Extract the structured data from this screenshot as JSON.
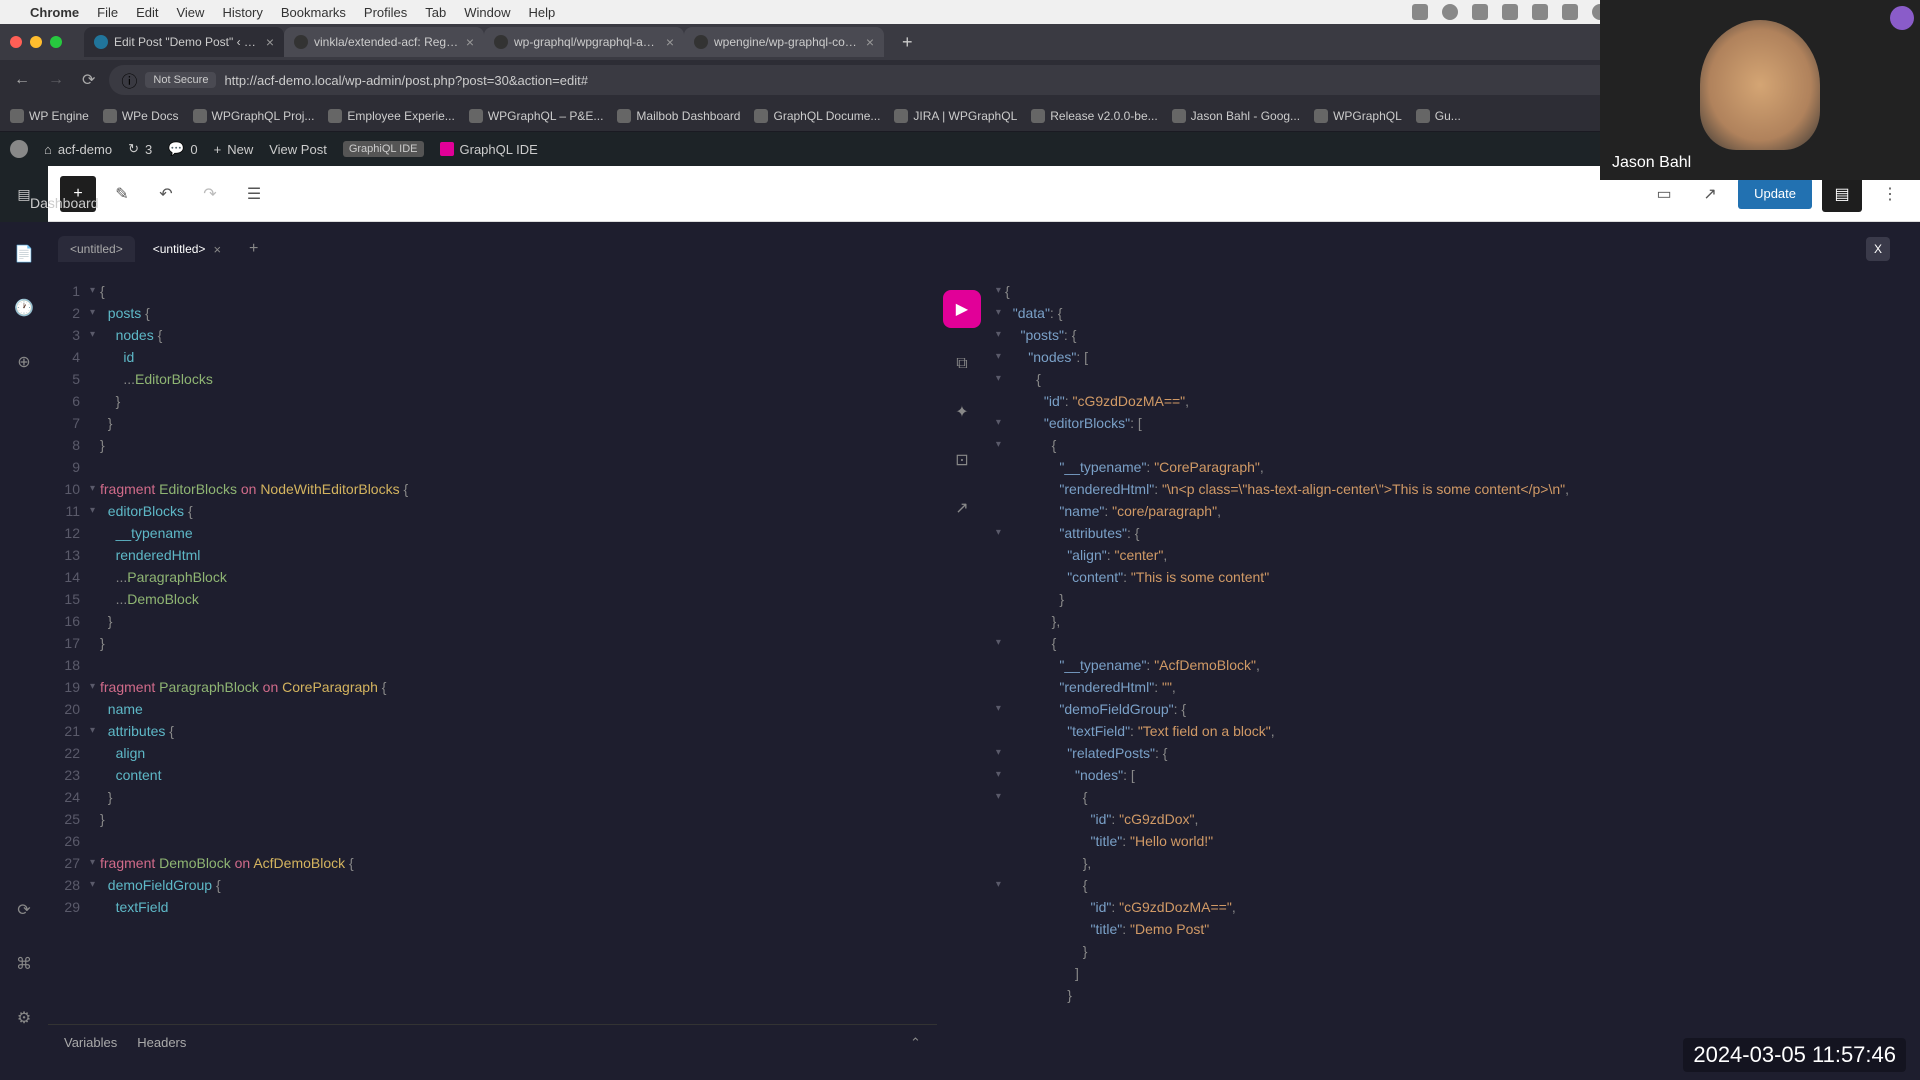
{
  "mac_menu": {
    "app": "Chrome",
    "items": [
      "File",
      "Edit",
      "View",
      "History",
      "Bookmarks",
      "Profiles",
      "Tab",
      "Window",
      "Help"
    ]
  },
  "browser": {
    "tabs": [
      {
        "title": "Edit Post \"Demo Post\" ‹ acf...",
        "active": true,
        "favicon": "wp"
      },
      {
        "title": "vinkla/extended-acf: Register...",
        "active": false,
        "favicon": "gh"
      },
      {
        "title": "wp-graphql/wpgraphql-acf: F...",
        "active": false,
        "favicon": "gh"
      },
      {
        "title": "wpengine/wp-graphql-conten...",
        "active": false,
        "favicon": "gh"
      }
    ],
    "url_not_secure": "Not Secure",
    "url": "http://acf-demo.local/wp-admin/post.php?post=30&action=edit#",
    "bookmarks": [
      "WP Engine",
      "WPe Docs",
      "WPGraphQL Proj...",
      "Employee Experie...",
      "WPGraphQL – P&E...",
      "Mailbob Dashboard",
      "GraphQL Docume...",
      "JIRA | WPGraphQL",
      "Release v2.0.0-be...",
      "Jason Bahl - Goog...",
      "WPGraphQL",
      "Gu..."
    ]
  },
  "wp_adminbar": {
    "site": "acf-demo",
    "updates": "3",
    "comments": "0",
    "new": "New",
    "view": "View Post",
    "graphiql1": "GraphiQL IDE",
    "graphiql2": "GraphQL IDE"
  },
  "editor_toolbar": {
    "update": "Update"
  },
  "dashboard": "Dashboard",
  "graphiql": {
    "tabs": [
      {
        "label": "<untitled>",
        "closable": false
      },
      {
        "label": "<untitled>",
        "closable": true
      }
    ],
    "close_panel": "X",
    "query_lines": [
      {
        "n": 1,
        "arrow": "▾",
        "html": "<span class='punct'>{</span>"
      },
      {
        "n": 2,
        "arrow": "▾",
        "html": "  <span class='k-cyan'>posts</span> <span class='punct'>{</span>"
      },
      {
        "n": 3,
        "arrow": "▾",
        "html": "    <span class='k-cyan'>nodes</span> <span class='punct'>{</span>"
      },
      {
        "n": 4,
        "arrow": "",
        "html": "      <span class='k-cyan'>id</span>"
      },
      {
        "n": 5,
        "arrow": "",
        "html": "      <span class='punct'>...</span><span class='k-green'>EditorBlocks</span>"
      },
      {
        "n": 6,
        "arrow": "",
        "html": "    <span class='punct'>}</span>"
      },
      {
        "n": 7,
        "arrow": "",
        "html": "  <span class='punct'>}</span>"
      },
      {
        "n": 8,
        "arrow": "",
        "html": "<span class='punct'>}</span>"
      },
      {
        "n": 9,
        "arrow": "",
        "html": ""
      },
      {
        "n": 10,
        "arrow": "▾",
        "html": "<span class='k-pink'>fragment</span> <span class='k-green'>EditorBlocks</span> <span class='k-pink'>on</span> <span class='k-yellow'>NodeWithEditorBlocks</span> <span class='punct'>{</span>"
      },
      {
        "n": 11,
        "arrow": "▾",
        "html": "  <span class='k-cyan'>editorBlocks</span> <span class='punct'>{</span>"
      },
      {
        "n": 12,
        "arrow": "",
        "html": "    <span class='k-cyan'>__typename</span>"
      },
      {
        "n": 13,
        "arrow": "",
        "html": "    <span class='k-cyan'>renderedHtml</span>"
      },
      {
        "n": 14,
        "arrow": "",
        "html": "    <span class='punct'>...</span><span class='k-green'>ParagraphBlock</span>"
      },
      {
        "n": 15,
        "arrow": "",
        "html": "    <span class='punct'>...</span><span class='k-green'>DemoBlock</span>"
      },
      {
        "n": 16,
        "arrow": "",
        "html": "  <span class='punct'>}</span>"
      },
      {
        "n": 17,
        "arrow": "",
        "html": "<span class='punct'>}</span>"
      },
      {
        "n": 18,
        "arrow": "",
        "html": ""
      },
      {
        "n": 19,
        "arrow": "▾",
        "html": "<span class='k-pink'>fragment</span> <span class='k-green'>ParagraphBlock</span> <span class='k-pink'>on</span> <span class='k-yellow'>CoreParagraph</span> <span class='punct'>{</span>"
      },
      {
        "n": 20,
        "arrow": "",
        "html": "  <span class='k-cyan'>name</span>"
      },
      {
        "n": 21,
        "arrow": "▾",
        "html": "  <span class='k-cyan'>attributes</span> <span class='punct'>{</span>"
      },
      {
        "n": 22,
        "arrow": "",
        "html": "    <span class='k-cyan'>align</span>"
      },
      {
        "n": 23,
        "arrow": "",
        "html": "    <span class='k-cyan'>content</span>"
      },
      {
        "n": 24,
        "arrow": "",
        "html": "  <span class='punct'>}</span>"
      },
      {
        "n": 25,
        "arrow": "",
        "html": "<span class='punct'>}</span>"
      },
      {
        "n": 26,
        "arrow": "",
        "html": ""
      },
      {
        "n": 27,
        "arrow": "▾",
        "html": "<span class='k-pink'>fragment</span> <span class='k-green'>DemoBlock</span> <span class='k-pink'>on</span> <span class='k-yellow'>AcfDemoBlock</span> <span class='punct'>{</span>"
      },
      {
        "n": 28,
        "arrow": "▾",
        "html": "  <span class='k-cyan'>demoFieldGroup</span> <span class='punct'>{</span>"
      },
      {
        "n": 29,
        "arrow": "",
        "html": "    <span class='k-cyan'>textField</span>"
      }
    ],
    "result_lines": [
      {
        "arrow": "▾",
        "html": "<span class='punct'>{</span>"
      },
      {
        "arrow": "▾",
        "html": "  <span class='k-key'>\"data\"</span><span class='punct'>: {</span>"
      },
      {
        "arrow": "▾",
        "html": "    <span class='k-key'>\"posts\"</span><span class='punct'>: {</span>"
      },
      {
        "arrow": "▾",
        "html": "      <span class='k-key'>\"nodes\"</span><span class='punct'>: [</span>"
      },
      {
        "arrow": "▾",
        "html": "        <span class='punct'>{</span>"
      },
      {
        "arrow": "",
        "html": "          <span class='k-key'>\"id\"</span><span class='punct'>: </span><span class='k-str'>\"cG9zdDozMA==\"</span><span class='punct'>,</span>"
      },
      {
        "arrow": "▾",
        "html": "          <span class='k-key'>\"editorBlocks\"</span><span class='punct'>: [</span>"
      },
      {
        "arrow": "▾",
        "html": "            <span class='punct'>{</span>"
      },
      {
        "arrow": "",
        "html": "              <span class='k-key'>\"__typename\"</span><span class='punct'>: </span><span class='k-str'>\"CoreParagraph\"</span><span class='punct'>,</span>"
      },
      {
        "arrow": "",
        "html": "              <span class='k-key'>\"renderedHtml\"</span><span class='punct'>: </span><span class='k-str'>\"\\n&lt;p class=\\\"has-text-align-center\\\"&gt;This is some content&lt;/p&gt;\\n\"</span><span class='punct'>,</span>"
      },
      {
        "arrow": "",
        "html": "              <span class='k-key'>\"name\"</span><span class='punct'>: </span><span class='k-str'>\"core/paragraph\"</span><span class='punct'>,</span>"
      },
      {
        "arrow": "▾",
        "html": "              <span class='k-key'>\"attributes\"</span><span class='punct'>: {</span>"
      },
      {
        "arrow": "",
        "html": "                <span class='k-key'>\"align\"</span><span class='punct'>: </span><span class='k-str'>\"center\"</span><span class='punct'>,</span>"
      },
      {
        "arrow": "",
        "html": "                <span class='k-key'>\"content\"</span><span class='punct'>: </span><span class='k-str'>\"This is some content\"</span>"
      },
      {
        "arrow": "",
        "html": "              <span class='punct'>}</span>"
      },
      {
        "arrow": "",
        "html": "            <span class='punct'>},</span>"
      },
      {
        "arrow": "▾",
        "html": "            <span class='punct'>{</span>"
      },
      {
        "arrow": "",
        "html": "              <span class='k-key'>\"__typename\"</span><span class='punct'>: </span><span class='k-str'>\"AcfDemoBlock\"</span><span class='punct'>,</span>"
      },
      {
        "arrow": "",
        "html": "              <span class='k-key'>\"renderedHtml\"</span><span class='punct'>: </span><span class='k-str'>\"\"</span><span class='punct'>,</span>"
      },
      {
        "arrow": "▾",
        "html": "              <span class='k-key'>\"demoFieldGroup\"</span><span class='punct'>: {</span>"
      },
      {
        "arrow": "",
        "html": "                <span class='k-key'>\"textField\"</span><span class='punct'>: </span><span class='k-str'>\"Text field on a block\"</span><span class='punct'>,</span>"
      },
      {
        "arrow": "▾",
        "html": "                <span class='k-key'>\"relatedPosts\"</span><span class='punct'>: {</span>"
      },
      {
        "arrow": "▾",
        "html": "                  <span class='k-key'>\"nodes\"</span><span class='punct'>: [</span>"
      },
      {
        "arrow": "▾",
        "html": "                    <span class='punct'>{</span>"
      },
      {
        "arrow": "",
        "html": "                      <span class='k-key'>\"id\"</span><span class='punct'>: </span><span class='k-str'>\"cG9zdDox\"</span><span class='punct'>,</span>"
      },
      {
        "arrow": "",
        "html": "                      <span class='k-key'>\"title\"</span><span class='punct'>: </span><span class='k-str'>\"Hello world!\"</span>"
      },
      {
        "arrow": "",
        "html": "                    <span class='punct'>},</span>"
      },
      {
        "arrow": "▾",
        "html": "                    <span class='punct'>{</span>"
      },
      {
        "arrow": "",
        "html": "                      <span class='k-key'>\"id\"</span><span class='punct'>: </span><span class='k-str'>\"cG9zdDozMA==\"</span><span class='punct'>,</span>"
      },
      {
        "arrow": "",
        "html": "                      <span class='k-key'>\"title\"</span><span class='punct'>: </span><span class='k-str'>\"Demo Post\"</span>"
      },
      {
        "arrow": "",
        "html": "                    <span class='punct'>}</span>"
      },
      {
        "arrow": "",
        "html": "                  <span class='punct'>]</span>"
      },
      {
        "arrow": "",
        "html": "                <span class='punct'>}</span>"
      }
    ],
    "footer": {
      "variables": "Variables",
      "headers": "Headers"
    }
  },
  "webcam": {
    "name": "Jason Bahl"
  },
  "timestamp": "2024-03-05 11:57:46"
}
